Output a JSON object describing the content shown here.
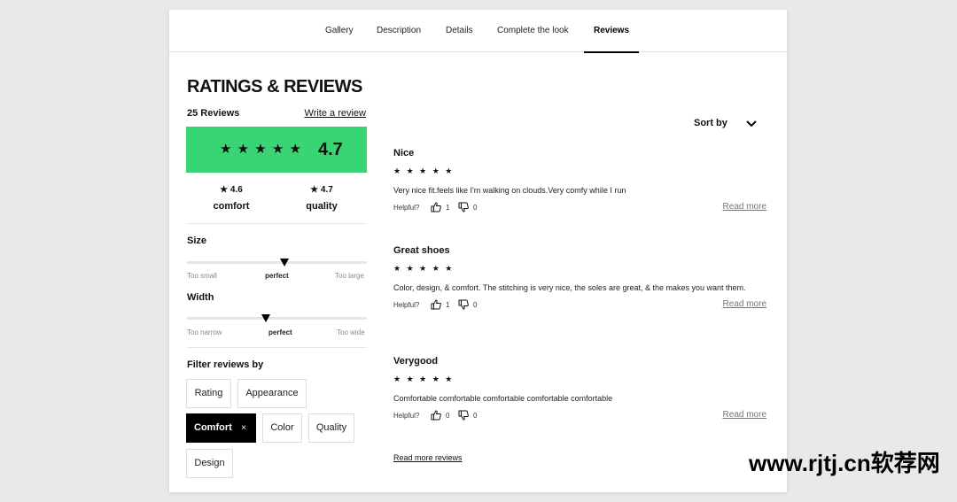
{
  "tabs": [
    "Gallery",
    "Description",
    "Details",
    "Complete the look",
    "Reviews"
  ],
  "active_tab": "Reviews",
  "summary": {
    "heading": "RATINGS & REVIEWS",
    "review_count": "25 Reviews",
    "write_review": "Write a review",
    "stars": "★★★★★",
    "overall_rating": "4.7",
    "score_color": "#39d574",
    "comfort_value": "★ 4.6",
    "comfort_label": "comfort",
    "quality_value": "★ 4.7",
    "quality_label": "quality"
  },
  "size": {
    "title": "Size",
    "low": "Too small",
    "mid": "perfect",
    "high": "Too large",
    "level": 0.54
  },
  "width": {
    "title": "Width",
    "low": "Too narrow",
    "mid": "perfect",
    "high": "Too wide",
    "level": 0.44
  },
  "filters": {
    "title": "Filter reviews by",
    "chips": [
      "Rating",
      "Appearance",
      "Comfort",
      "Color",
      "Quality",
      "Design"
    ],
    "active": "Comfort",
    "remove_glyph": "×"
  },
  "sort": {
    "label": "Sort by"
  },
  "reviews": [
    {
      "title": "Nice",
      "stars": "★★★★★",
      "body": "Very nice fit.feels like I'm walking on clouds.Very comfy while I run",
      "helpful_label": "Helpful?",
      "up": "1",
      "down": "0",
      "read_more": "Read more"
    },
    {
      "title": "Great shoes",
      "stars": "★★★★★",
      "body": "Color, design, & comfort. The stitching is very nice, the soles are great, & the makes you want them.",
      "helpful_label": "Helpful?",
      "up": "1",
      "down": "0",
      "read_more": "Read more"
    },
    {
      "title": "Verygood",
      "stars": "★★★★★",
      "body": "Comfortable comfortable comfortable comfortable comfortable",
      "helpful_label": "Helpful?",
      "up": "0",
      "down": "0",
      "read_more": "Read more"
    }
  ],
  "read_more_reviews": "Read more reviews",
  "watermark": "www.rjtj.cn软荐网"
}
